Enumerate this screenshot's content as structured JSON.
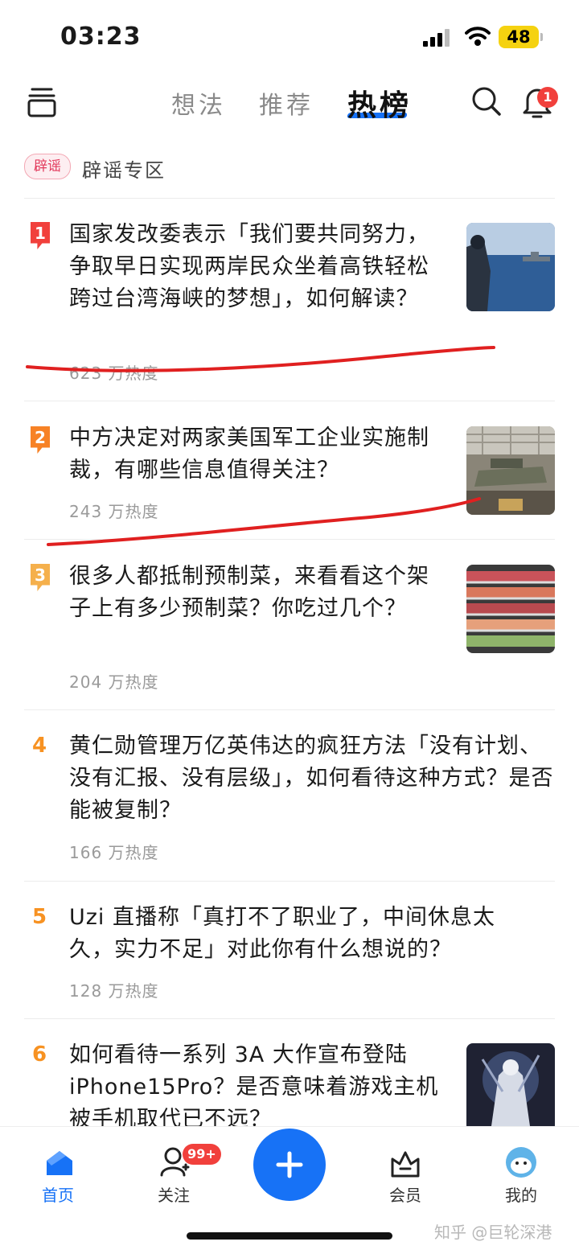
{
  "status_bar": {
    "time": "03:23",
    "battery": "48"
  },
  "header": {
    "tabs": [
      {
        "label": "想法"
      },
      {
        "label": "推荐"
      },
      {
        "label": "热榜"
      }
    ],
    "notification_count": "1"
  },
  "rumor": {
    "tag": "辟谣",
    "label": "辟谣专区"
  },
  "items": [
    {
      "rank": "1",
      "title": "国家发改委表示「我们要共同努力，争取早日实现两岸民众坐着高铁轻松跨过台湾海峡的梦想」，如何解读？",
      "heat": "623 万热度",
      "flag_color": "#f1403c"
    },
    {
      "rank": "2",
      "title": "中方决定对两家美国军工企业实施制裁，有哪些信息值得关注？",
      "heat": "243 万热度",
      "flag_color": "#f78226"
    },
    {
      "rank": "3",
      "title": "很多人都抵制预制菜，来看看这个架子上有多少预制菜？你吃过几个？",
      "heat": "204 万热度",
      "flag_color": "#f5b04c"
    },
    {
      "rank": "4",
      "title": "黄仁勋管理万亿英伟达的疯狂方法「没有计划、没有汇报、没有层级」，如何看待这种方式？是否能被复制？",
      "heat": "166 万热度"
    },
    {
      "rank": "5",
      "title": "Uzi 直播称「真打不了职业了，中间休息太久，实力不足」对此你有什么想说的？",
      "heat": "128 万热度"
    },
    {
      "rank": "6",
      "title": "如何看待一系列 3A 大作宣布登陆 iPhone15Pro？是否意味着游戏主机被手机取代已不远？"
    }
  ],
  "bottom_nav": {
    "home": "首页",
    "follow": "关注",
    "follow_badge": "99+",
    "vip": "会员",
    "mine": "我的"
  },
  "watermark": "知乎 @巨轮深港",
  "colors": {
    "accent": "#1772f6",
    "badge_red": "#f1403c",
    "rank_orange": "#f79222",
    "annotation_red": "#e02020"
  }
}
